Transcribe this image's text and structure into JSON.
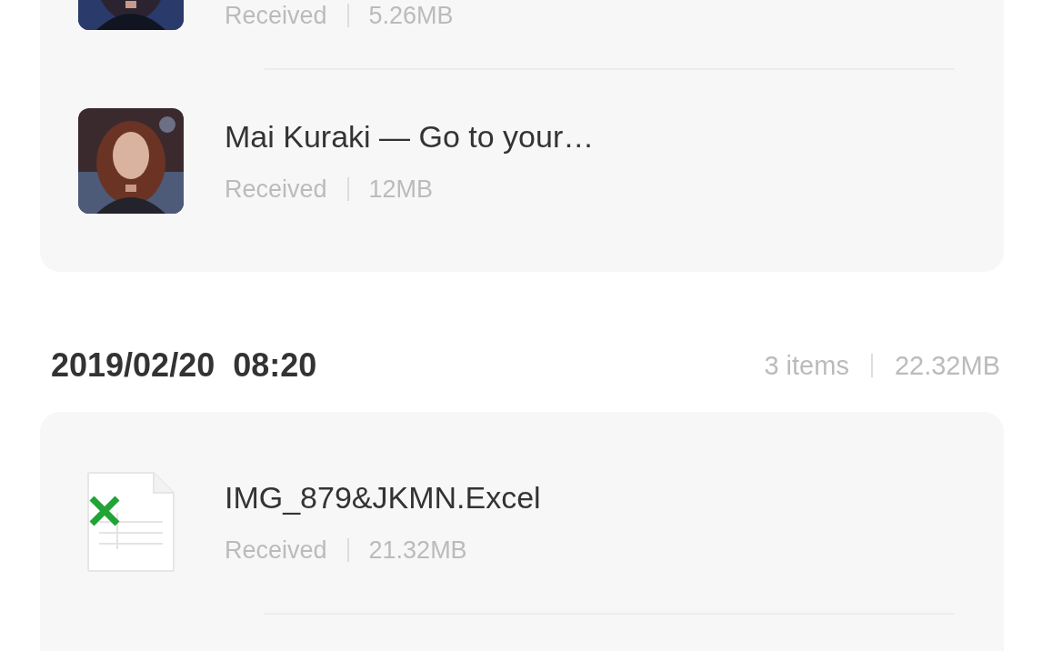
{
  "groups": [
    {
      "items": [
        {
          "kind": "picture",
          "status": "Received",
          "size": "5.26MB"
        },
        {
          "kind": "picture",
          "title": "Mai Kuraki — Go to your…",
          "status": "Received",
          "size": "12MB"
        }
      ]
    },
    {
      "date": "2019/02/20  08:20",
      "count": "3 items",
      "total": "22.32MB",
      "items": [
        {
          "kind": "excel",
          "title": "IMG_879&JKMN.Excel",
          "status": "Received",
          "size": "21.32MB"
        }
      ]
    }
  ]
}
